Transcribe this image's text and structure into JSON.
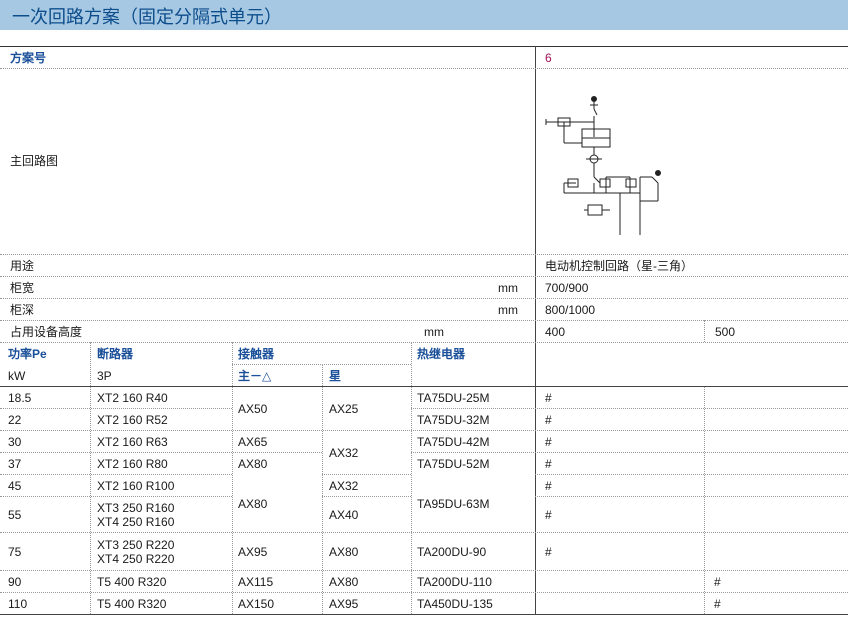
{
  "title": "一次回路方案（固定分隔式单元）",
  "header": {
    "scheme_no_label": "方案号",
    "scheme_no_value": "6",
    "main_circuit_label": "主回路图"
  },
  "specs": {
    "usage_label": "用途",
    "usage_value": "电动机控制回路（星-三角）",
    "width_label": "柜宽",
    "width_unit": "mm",
    "width_value": "700/900",
    "depth_label": "柜深",
    "depth_unit": "mm",
    "depth_value": "800/1000",
    "height_label": "占用设备高度",
    "height_unit": "mm",
    "height_value_1": "400",
    "height_value_2": "500"
  },
  "table": {
    "col_power": "功率Pe",
    "col_power_unit": "kW",
    "col_breaker": "断路器",
    "col_breaker_sub": "3P",
    "col_contactor": "接触器",
    "col_contactor_main": "主－△",
    "col_contactor_star": "星",
    "col_relay": "热继电器",
    "power": [
      "18.5",
      "22",
      "30",
      "37",
      "45",
      "55",
      "75",
      "90",
      "110"
    ],
    "breaker": [
      "XT2 160 R40",
      "XT2 160 R52",
      "XT2 160 R63",
      "XT2 160 R80",
      "XT2 160 R100",
      "XT3 250 R160",
      "XT4 250 R160",
      "XT3 250 R220",
      "XT4 250 R220",
      "T5 400 R320",
      "T5 400 R320"
    ],
    "contactor_main": [
      "AX50",
      "AX65",
      "AX80",
      "AX80",
      "AX95",
      "AX115",
      "AX150"
    ],
    "contactor_star": [
      "AX25",
      "AX32",
      "AX32",
      "AX40",
      "AX80",
      "AX80",
      "AX95"
    ],
    "relay": [
      "TA75DU-25M",
      "TA75DU-32M",
      "TA75DU-42M",
      "TA75DU-52M",
      "TA95DU-63M",
      "TA200DU-90",
      "TA200DU-110",
      "TA450DU-135"
    ],
    "mark": "#"
  }
}
